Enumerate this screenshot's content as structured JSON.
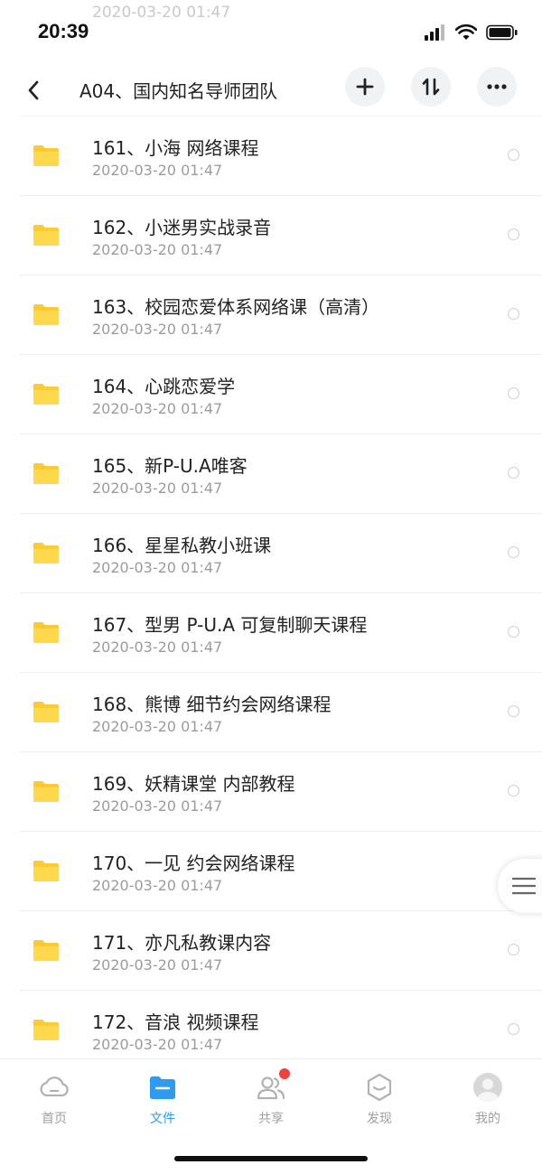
{
  "status": {
    "time": "20:39"
  },
  "ghost_date": "2020-03-20 01:47",
  "header": {
    "title": "A04、国内知名导师团队"
  },
  "files": [
    {
      "name": "161、小海 网络课程",
      "date": "2020-03-20 01:47"
    },
    {
      "name": "162、小迷男实战录音",
      "date": "2020-03-20 01:47"
    },
    {
      "name": "163、校园恋爱体系网络课（高清）",
      "date": "2020-03-20 01:47"
    },
    {
      "name": "164、心跳恋爱学",
      "date": "2020-03-20 01:47"
    },
    {
      "name": "165、新P-U.A唯客",
      "date": "2020-03-20 01:47"
    },
    {
      "name": "166、星星私教小班课",
      "date": "2020-03-20 01:47"
    },
    {
      "name": "167、型男 P-U.A 可复制聊天课程",
      "date": "2020-03-20 01:47"
    },
    {
      "name": "168、熊博 细节约会网络课程",
      "date": "2020-03-20 01:47"
    },
    {
      "name": "169、妖精课堂 内部教程",
      "date": "2020-03-20 01:47"
    },
    {
      "name": "170、一见 约会网络课程",
      "date": "2020-03-20 01:47"
    },
    {
      "name": "171、亦凡私教课内容",
      "date": "2020-03-20 01:47"
    },
    {
      "name": "172、音浪 视频课程",
      "date": "2020-03-20 01:47"
    }
  ],
  "tabs": [
    {
      "label": "首页",
      "icon": "cloud-icon",
      "active": false
    },
    {
      "label": "文件",
      "icon": "folder-icon",
      "active": true
    },
    {
      "label": "共享",
      "icon": "people-icon",
      "active": false,
      "badge": true
    },
    {
      "label": "发现",
      "icon": "discover-icon",
      "active": false
    },
    {
      "label": "我的",
      "icon": "avatar-icon",
      "active": false
    }
  ],
  "colors": {
    "folder": "#FFCB2E",
    "accent": "#2E9BF0",
    "badge": "#F2403C"
  }
}
